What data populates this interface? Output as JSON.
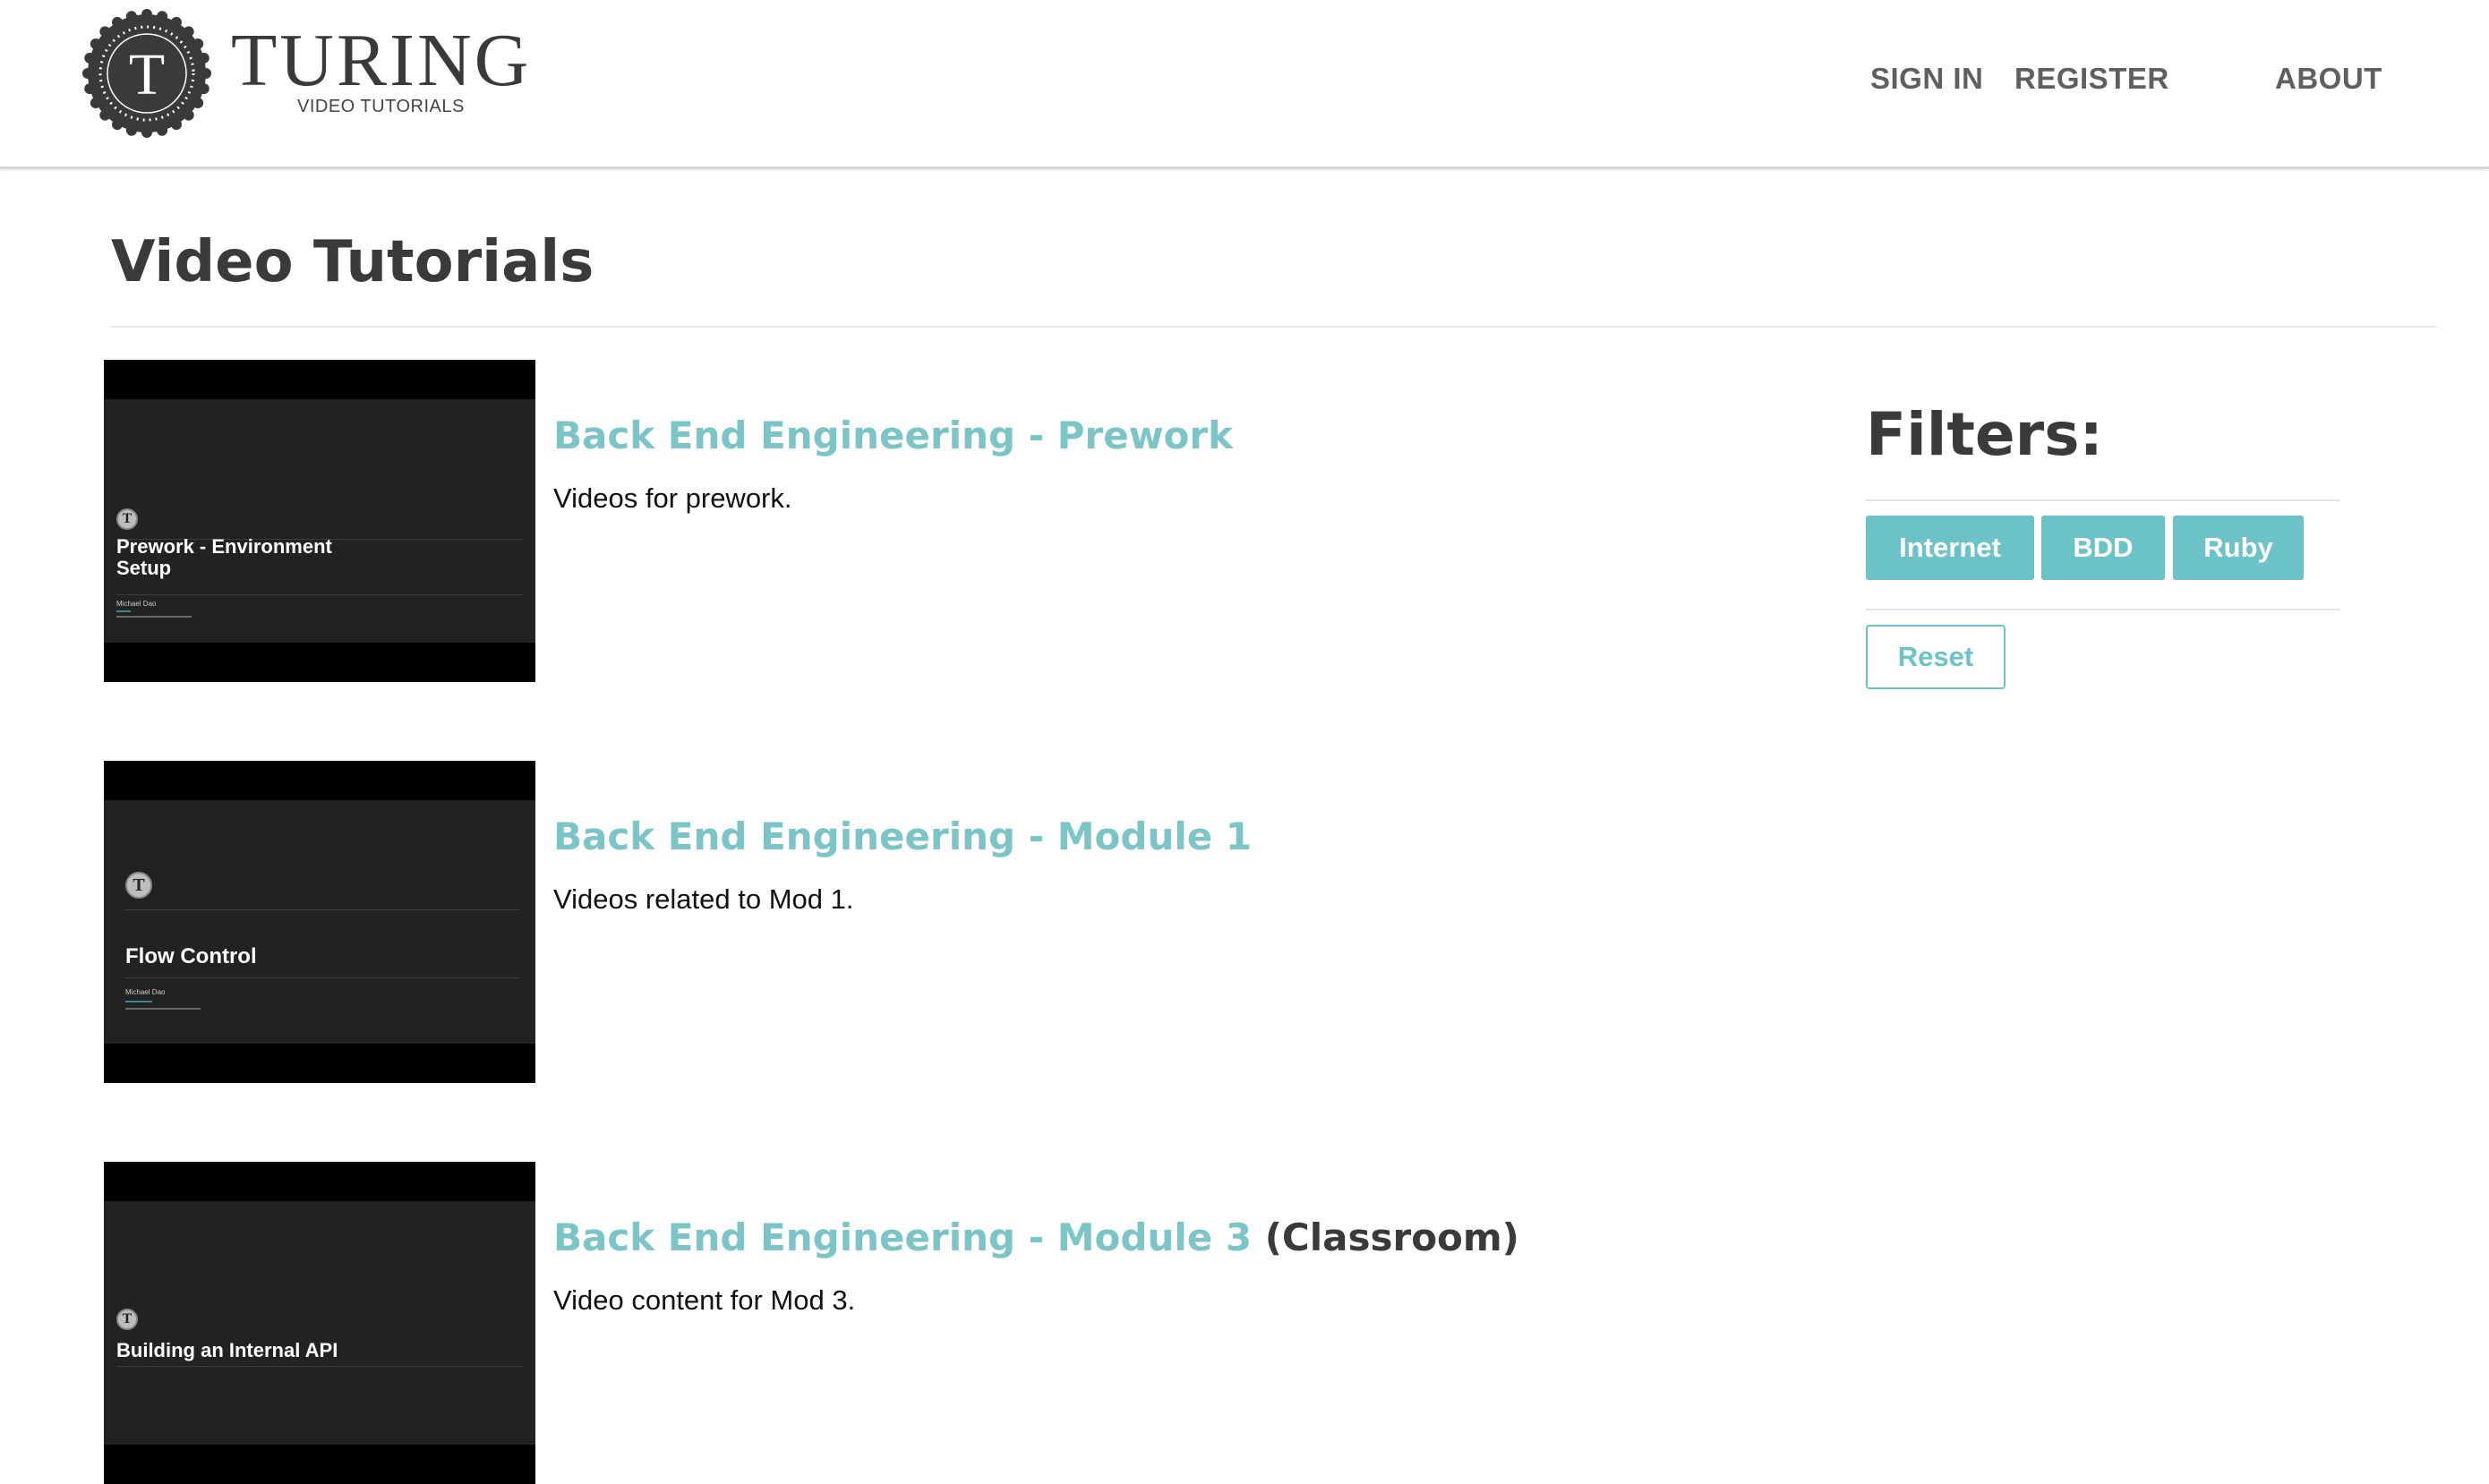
{
  "header": {
    "logo_letter": "T",
    "brand": "TURING",
    "brand_sub": "VIDEO TUTORIALS",
    "nav": {
      "sign_in": "SIGN IN",
      "register": "REGISTER",
      "about": "ABOUT"
    }
  },
  "page_title": "Video Tutorials",
  "videos": [
    {
      "thumb_lines": [
        "Prework - Environment",
        "Setup"
      ],
      "thumb_author": "Michael Dao",
      "title": "Back End Engineering - Prework",
      "title_note": "",
      "description": "Videos for prework."
    },
    {
      "thumb_lines": [
        "Flow Control",
        ""
      ],
      "thumb_author": "Michael Dao",
      "title": "Back End Engineering - Module 1",
      "title_note": "",
      "description": "Videos related to Mod 1."
    },
    {
      "thumb_lines": [
        "Building an Internal API",
        ""
      ],
      "thumb_author": "",
      "title": "Back End Engineering - Module 3",
      "title_note": "(Classroom)",
      "description": "Video content for Mod 3."
    }
  ],
  "filters": {
    "title": "Filters:",
    "tags": [
      "Internet",
      "BDD",
      "Ruby"
    ],
    "reset_label": "Reset"
  },
  "colors": {
    "accent": "#6bc3c7",
    "title_link": "#7bc4c8",
    "text_dark": "#3a3a3a",
    "nav_text": "#5f5f5f",
    "thumb_bg": "#222222"
  }
}
